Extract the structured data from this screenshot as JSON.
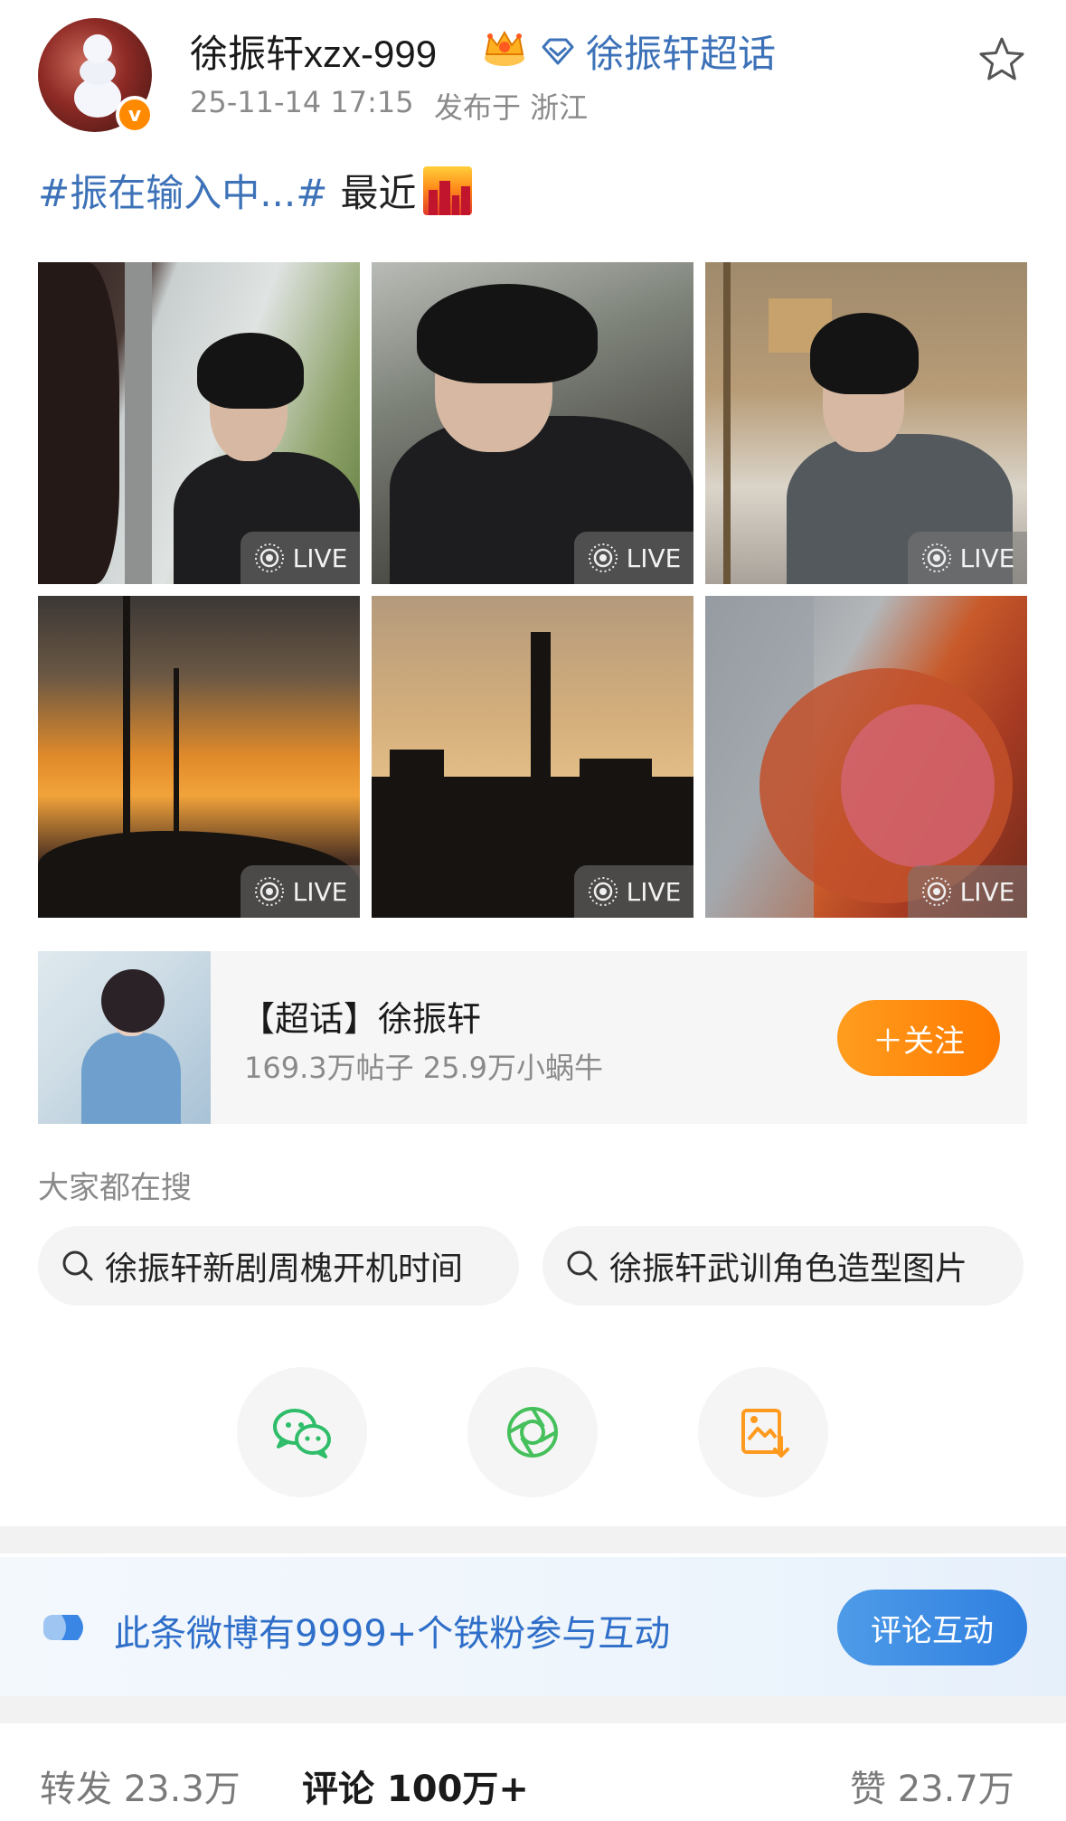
{
  "author": {
    "name": "徐振轩xzx-999",
    "supertopic_link": "徐振轩超话",
    "timestamp": "25-11-14 17:15",
    "location": "发布于 浙江",
    "verified_mark": "v"
  },
  "post": {
    "hashtag": "#振在输入中...#",
    "text": "最近"
  },
  "photos": [
    {
      "live_label": "LIVE"
    },
    {
      "live_label": "LIVE"
    },
    {
      "live_label": "LIVE"
    },
    {
      "live_label": "LIVE"
    },
    {
      "live_label": "LIVE"
    },
    {
      "live_label": "LIVE"
    }
  ],
  "supertopic_card": {
    "title": "【超话】徐振轩",
    "stats": "169.3万帖子 25.9万小蜗牛",
    "follow_label": "＋关注"
  },
  "hot_search": {
    "title": "大家都在搜",
    "items": [
      "徐振轩新剧周槐开机时间",
      "徐振轩武训角色造型图片"
    ]
  },
  "share": {
    "icons": [
      "wechat-icon",
      "moments-icon",
      "save-image-icon"
    ]
  },
  "fan_banner": {
    "text": "此条微博有9999+个铁粉参与互动",
    "button_label": "评论互动"
  },
  "stats": {
    "repost": "转发 23.3万",
    "comment": "评论 100万+",
    "like": "赞 23.7万"
  },
  "colors": {
    "link_blue": "#3d72b8",
    "follow_orange": "#ff8a00",
    "interact_blue": "#2f7fe0",
    "wechat_green": "#2fbd6a"
  }
}
